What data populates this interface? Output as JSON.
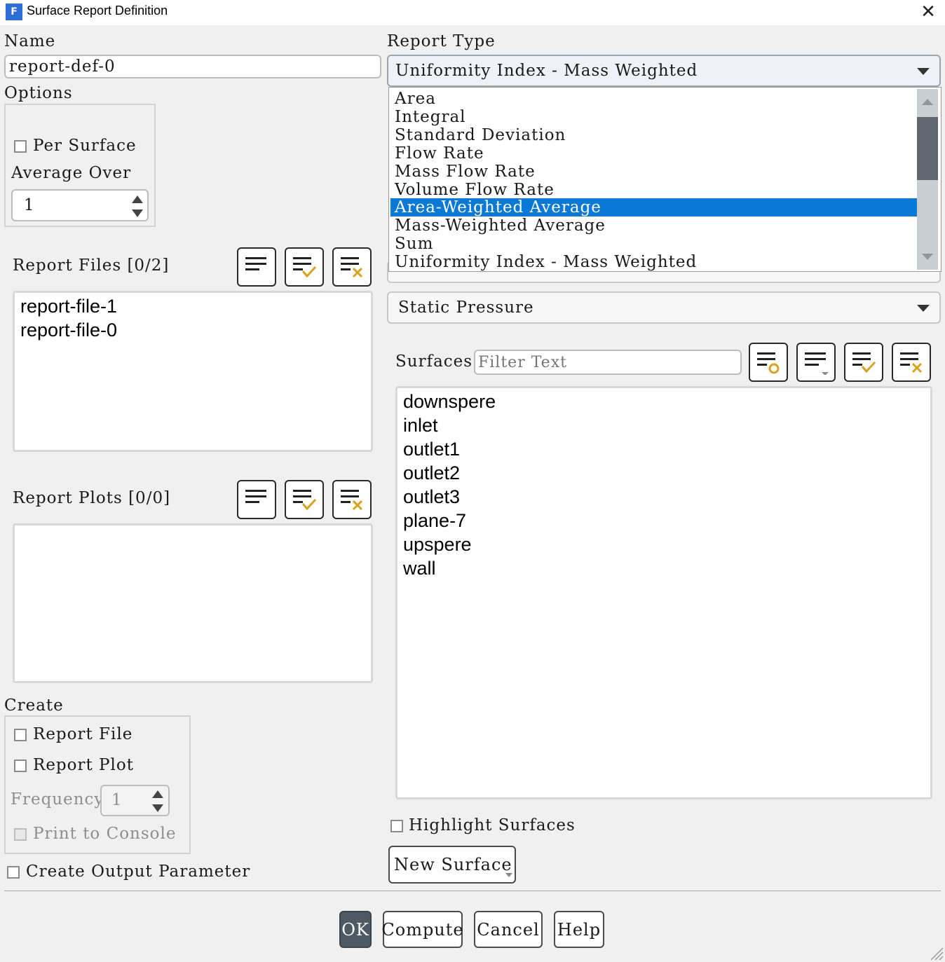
{
  "window": {
    "title": "Surface Report Definition",
    "app_icon_letter": "F"
  },
  "name": {
    "label": "Name",
    "value": "report-def-0"
  },
  "options": {
    "label": "Options",
    "per_surface_label": "Per Surface",
    "average_over_label": "Average Over",
    "average_over_value": "1"
  },
  "report_files": {
    "label": "Report Files [0/2]",
    "items": [
      "report-file-1",
      "report-file-0"
    ]
  },
  "report_plots": {
    "label": "Report Plots [0/0]",
    "items": []
  },
  "create": {
    "label": "Create",
    "report_file_label": "Report File",
    "report_plot_label": "Report Plot",
    "frequency_label": "Frequency",
    "frequency_value": "1",
    "print_to_console_label": "Print to Console"
  },
  "create_output_parameter_label": "Create Output Parameter",
  "report_type": {
    "label": "Report Type",
    "selected": "Uniformity Index - Mass Weighted",
    "options": [
      "Area",
      "Integral",
      "Standard Deviation",
      "Flow Rate",
      "Mass Flow Rate",
      "Volume Flow Rate",
      "Area-Weighted Average",
      "Mass-Weighted Average",
      "Sum",
      "Uniformity Index - Mass Weighted"
    ],
    "highlighted": "Area-Weighted Average"
  },
  "field_variable": {
    "selected": "Static Pressure"
  },
  "surfaces": {
    "label": "Surfaces",
    "filter_placeholder": "Filter Text",
    "items": [
      "downspere",
      "inlet",
      "outlet1",
      "outlet2",
      "outlet3",
      "plane-7",
      "upspere",
      "wall"
    ]
  },
  "highlight_surfaces_label": "Highlight Surfaces",
  "new_surface_label": "New Surface",
  "buttons": {
    "ok": "OK",
    "compute": "Compute",
    "cancel": "Cancel",
    "help": "Help"
  },
  "colors": {
    "selection": "#0a78d7",
    "accent_check": "#d9a21b",
    "ok_button": "#4e5a63"
  }
}
